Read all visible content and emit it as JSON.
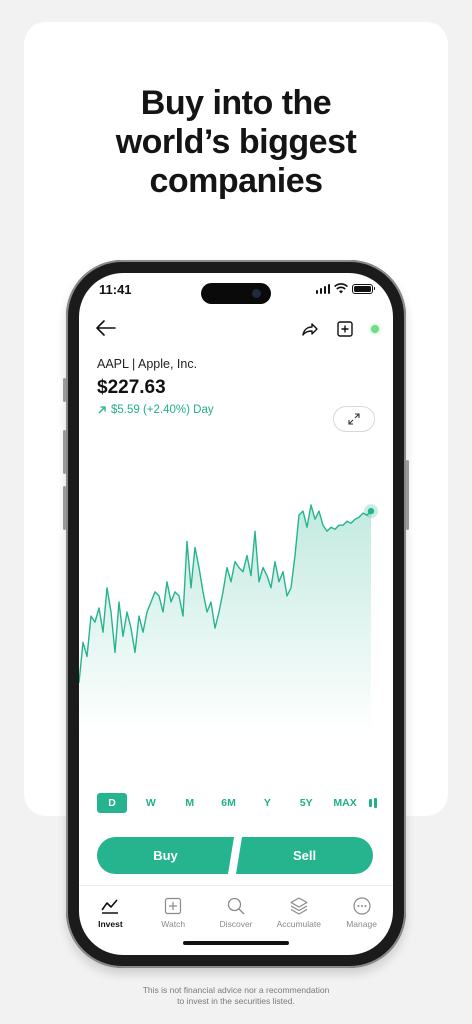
{
  "headline": {
    "line1": "Buy into the",
    "line2": "world’s biggest",
    "line3": "companies"
  },
  "status_bar": {
    "time": "11:41"
  },
  "stock": {
    "ticker_name": "AAPL | Apple, Inc.",
    "price": "$227.63",
    "change": "$5.59 (+2.40%) Day"
  },
  "colors": {
    "accent": "#26b48f",
    "live_dot": "#6fdc8c",
    "background": "#f2f2f2"
  },
  "chart_data": {
    "type": "area",
    "series": [
      {
        "values": [
          0.15,
          0.35,
          0.28,
          0.48,
          0.45,
          0.52,
          0.4,
          0.62,
          0.5,
          0.3,
          0.55,
          0.38,
          0.5,
          0.42,
          0.3,
          0.48,
          0.4,
          0.5,
          0.55,
          0.6,
          0.58,
          0.5,
          0.65,
          0.55,
          0.6,
          0.58,
          0.48,
          0.85,
          0.62,
          0.82,
          0.72,
          0.6,
          0.5,
          0.55,
          0.42,
          0.5,
          0.6,
          0.72,
          0.65,
          0.75,
          0.72,
          0.7,
          0.78,
          0.68,
          0.9,
          0.65,
          0.72,
          0.68,
          0.62,
          0.75,
          0.65,
          0.7,
          0.58,
          0.62,
          0.78,
          0.98,
          1.0,
          0.92,
          1.03,
          0.96,
          1.0,
          0.93,
          0.9,
          0.92,
          0.91,
          0.93,
          0.93,
          0.95,
          0.94,
          0.96,
          0.97,
          0.99,
          0.98,
          1.0
        ]
      }
    ]
  },
  "ranges": [
    "D",
    "W",
    "M",
    "6M",
    "Y",
    "5Y",
    "MAX"
  ],
  "active_range": "D",
  "actions": {
    "buy": "Buy",
    "sell": "Sell"
  },
  "tabs": [
    {
      "label": "Invest",
      "icon": "chart-line-icon"
    },
    {
      "label": "Watch",
      "icon": "plus-square-icon"
    },
    {
      "label": "Discover",
      "icon": "search-icon"
    },
    {
      "label": "Accumulate",
      "icon": "layers-icon"
    },
    {
      "label": "Manage",
      "icon": "more-icon"
    }
  ],
  "disclaimer": {
    "line1": "This is not financial advice nor a recommendation",
    "line2": "to invest in the securities listed."
  }
}
